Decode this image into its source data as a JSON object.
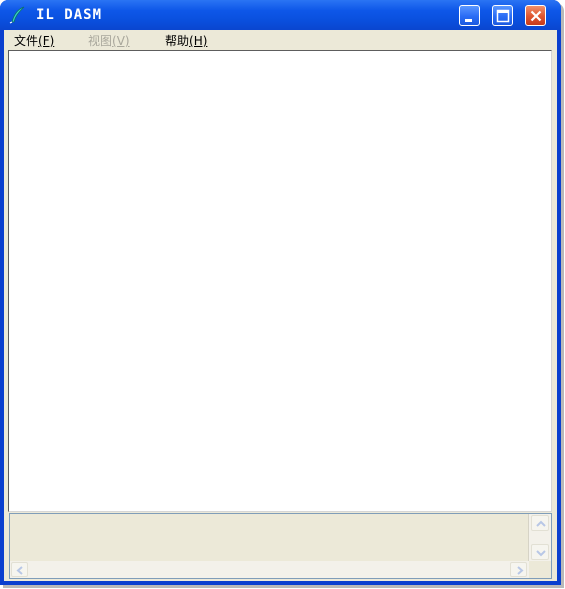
{
  "window": {
    "title": "IL DASM",
    "app_icon": "feather-icon"
  },
  "titlebar_buttons": {
    "minimize": "minimize-icon",
    "maximize": "maximize-icon",
    "close": "close-icon"
  },
  "menu": {
    "file": {
      "label": "文件",
      "accel": "(F)"
    },
    "view": {
      "label": "视图",
      "accel": "(V)",
      "disabled": true
    },
    "help": {
      "label": "帮助",
      "accel": "(H)"
    }
  },
  "colors": {
    "titlebar": "#0a4fdd",
    "client_bg": "#ece9d8",
    "close_button": "#df5530"
  }
}
